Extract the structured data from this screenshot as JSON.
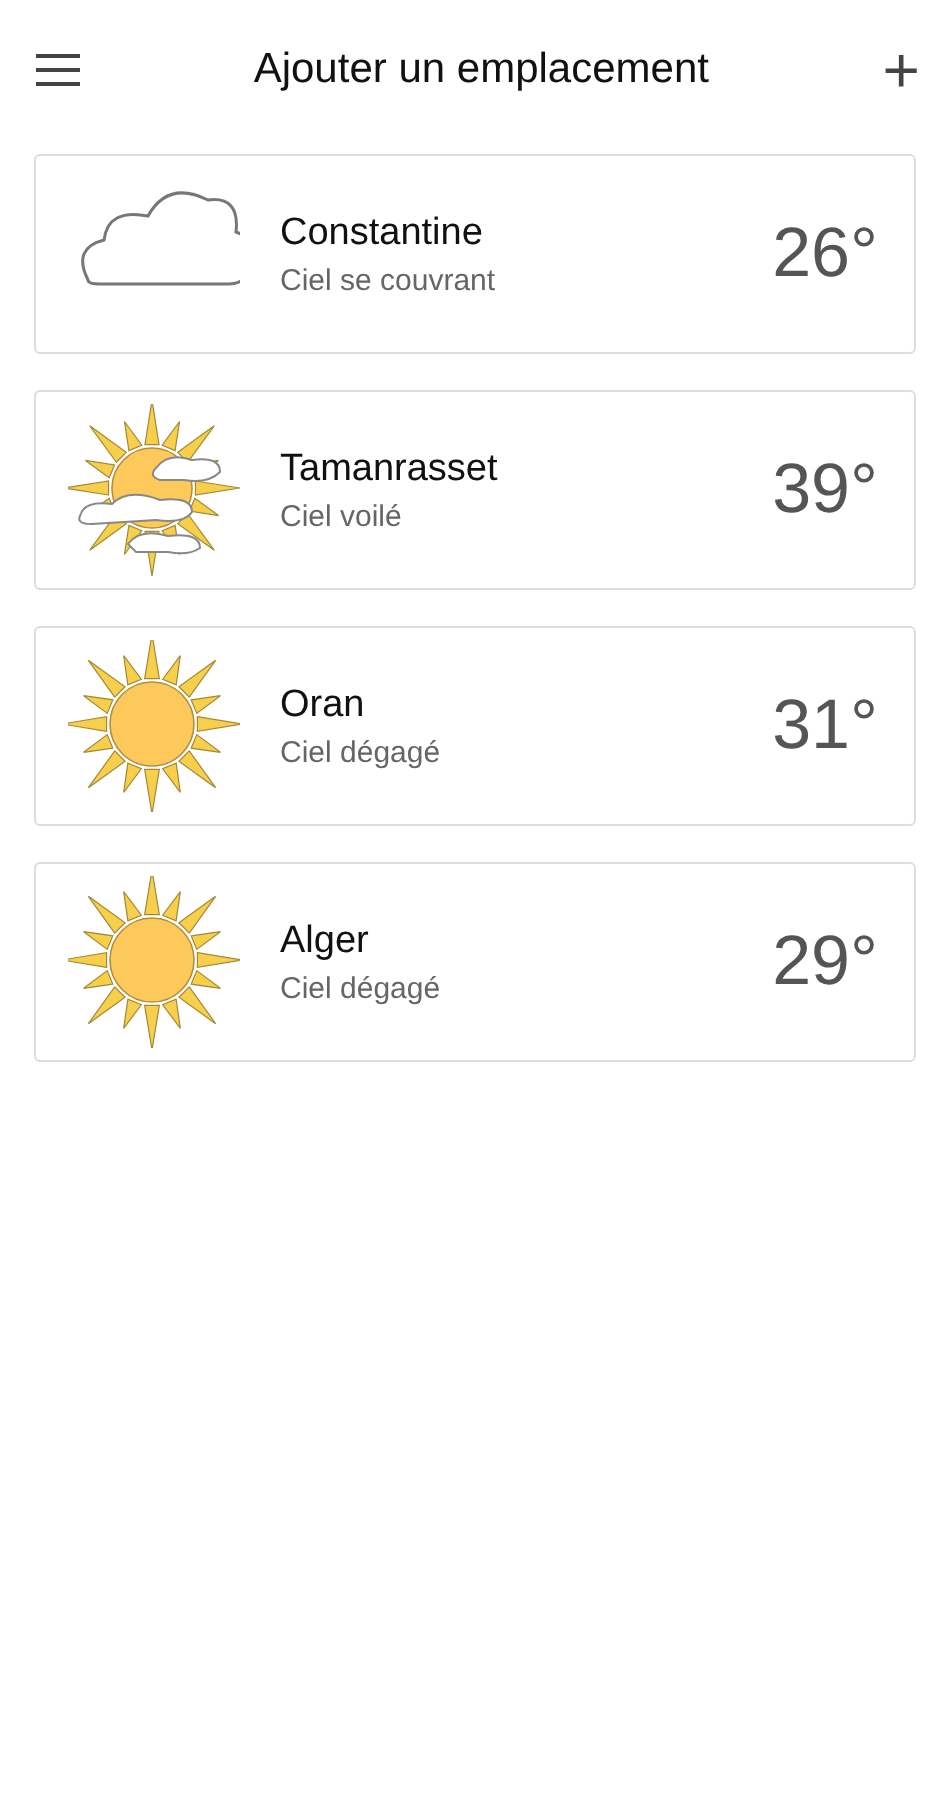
{
  "header": {
    "title": "Ajouter un emplacement",
    "add_label": "+"
  },
  "locations": [
    {
      "city": "Constantine",
      "condition": "Ciel se couvrant",
      "temperature": "26°",
      "kind": "cloud"
    },
    {
      "city": "Tamanrasset",
      "condition": "Ciel voilé",
      "temperature": "39°",
      "kind": "haze"
    },
    {
      "city": "Oran",
      "condition": "Ciel dégagé",
      "temperature": "31°",
      "kind": "sun"
    },
    {
      "city": "Alger",
      "condition": "Ciel dégagé",
      "temperature": "29°",
      "kind": "sun"
    }
  ]
}
